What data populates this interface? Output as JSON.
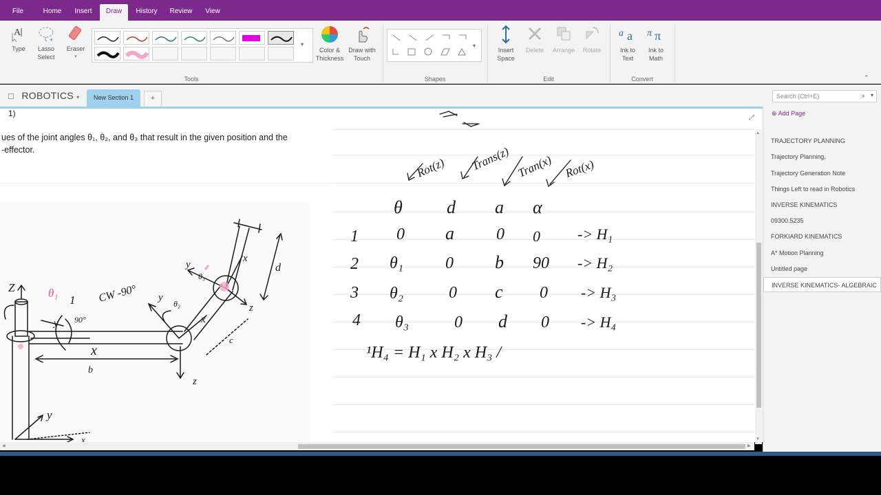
{
  "ribbon_tabs": [
    "File",
    "Home",
    "Insert",
    "Draw",
    "History",
    "Review",
    "View"
  ],
  "active_tab": "Draw",
  "tools": {
    "type_label": "Type",
    "lasso_label": "Lasso Select",
    "eraser_label": "Eraser",
    "color_label": "Color & Thickness",
    "touch_label": "Draw with Touch",
    "group_label": "Tools"
  },
  "pens": [
    {
      "color": "#222222"
    },
    {
      "color": "#c0392b"
    },
    {
      "color": "#2e6da4"
    },
    {
      "color": "#2e8b57"
    },
    {
      "color": "#777777"
    },
    {
      "color": "#e600e6"
    },
    {
      "color": "#111111"
    },
    {
      "color": "#111111"
    },
    {
      "color": "#f4a6c8"
    }
  ],
  "shapes_group": "Shapes",
  "edit": {
    "insert_space": "Insert Space",
    "delete": "Delete",
    "arrange": "Arrange",
    "rotate": "Rotate",
    "group_label": "Edit"
  },
  "convert": {
    "ink_to_text": "Ink to Text",
    "ink_to_math": "Ink to Math",
    "group_label": "Convert"
  },
  "notebook": "ROBOTICS",
  "section": "New Section 1",
  "add_section": "+",
  "search_placeholder": "Search (Ctrl+E)",
  "question": {
    "number": "1)",
    "line1": "ues of the joint angles θ₁, θ₂, and θ₃ that result in the given position and the",
    "line2": "-effector."
  },
  "dh_table": {
    "headers": [
      "θ",
      "d",
      "a",
      "α"
    ],
    "header_notes": [
      "Rot(z)",
      "Trans(z)",
      "Tran(x)",
      "Rot(x)"
    ],
    "rows": [
      {
        "index": "1",
        "theta": "0",
        "d": "a",
        "a": "0",
        "alpha": "0",
        "result": "-> H₁"
      },
      {
        "index": "2",
        "theta": "θ₁",
        "d": "0",
        "a": "b",
        "alpha": "90",
        "result": "-> H₂"
      },
      {
        "index": "3",
        "theta": "θ₂",
        "d": "0",
        "a": "c",
        "alpha": "0",
        "result": "-> H₃"
      },
      {
        "index": "4",
        "theta": "θ₃",
        "d": "0",
        "a": "d",
        "alpha": "0",
        "result": "-> H₄"
      }
    ],
    "equation": "¹H₄ = H₁ x H₂ x H₃ /"
  },
  "diagram_labels": {
    "z1": "Z",
    "theta1": "θ₁",
    "cw": "CW -90°",
    "y1": "y",
    "deg90": "90°",
    "x1": "x",
    "b": "b",
    "y2": "y",
    "theta2": "θ₂",
    "x2": "x",
    "z2": "z",
    "y3": "y",
    "theta3": "θ₃",
    "x3": "x",
    "z3": "z",
    "c": "c",
    "d": "d",
    "z4": "z",
    "ybase": "y",
    "xbase": "x",
    "one": "1"
  },
  "pages_panel": {
    "add_page": "Add Page",
    "items": [
      "TRAJECTORY PLANNING",
      "Trajectory Planning,",
      "Trajectory Generation Note",
      "Things Left to read in Robotics",
      "INVERSE KINEMATICS",
      "09300.5235",
      "FORKIARD KINEMATICS",
      "A* Motion Planning",
      "Untitled page",
      "INVERSE KINEMATICS- ALGEBRAIC"
    ]
  }
}
